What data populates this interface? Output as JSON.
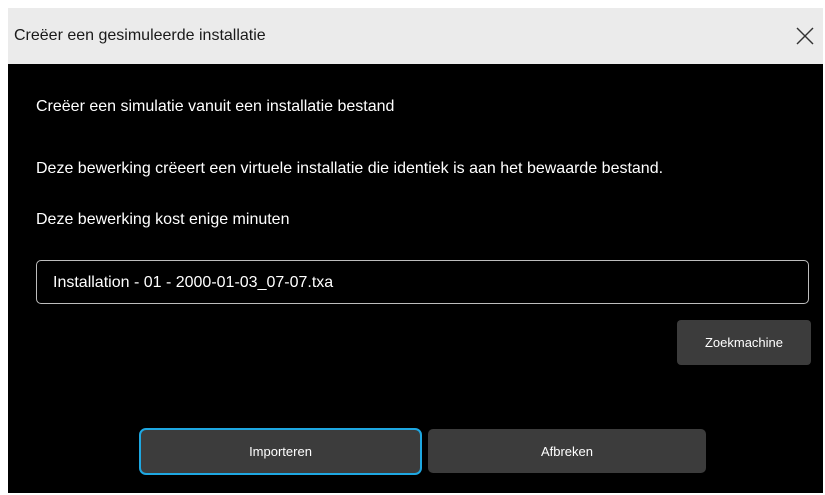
{
  "dialog": {
    "title": "Creëer een gesimuleerde installatie",
    "close_icon": "close-icon"
  },
  "body": {
    "line1": "Creëer een simulatie vanuit een installatie bestand",
    "line2": "Deze bewerking crëeert een virtuele installatie die identiek is aan het bewaarde bestand.",
    "line3": "Deze bewerking kost enige minuten"
  },
  "file": {
    "value": "Installation - 01 - 2000-01-03_07-07.txa"
  },
  "buttons": {
    "search": "Zoekmachine",
    "import": "Importeren",
    "cancel": "Afbreken"
  },
  "colors": {
    "titlebar": "#ebebeb",
    "background": "#000000",
    "button": "#3c3c3c",
    "focus": "#1ea7e1"
  }
}
